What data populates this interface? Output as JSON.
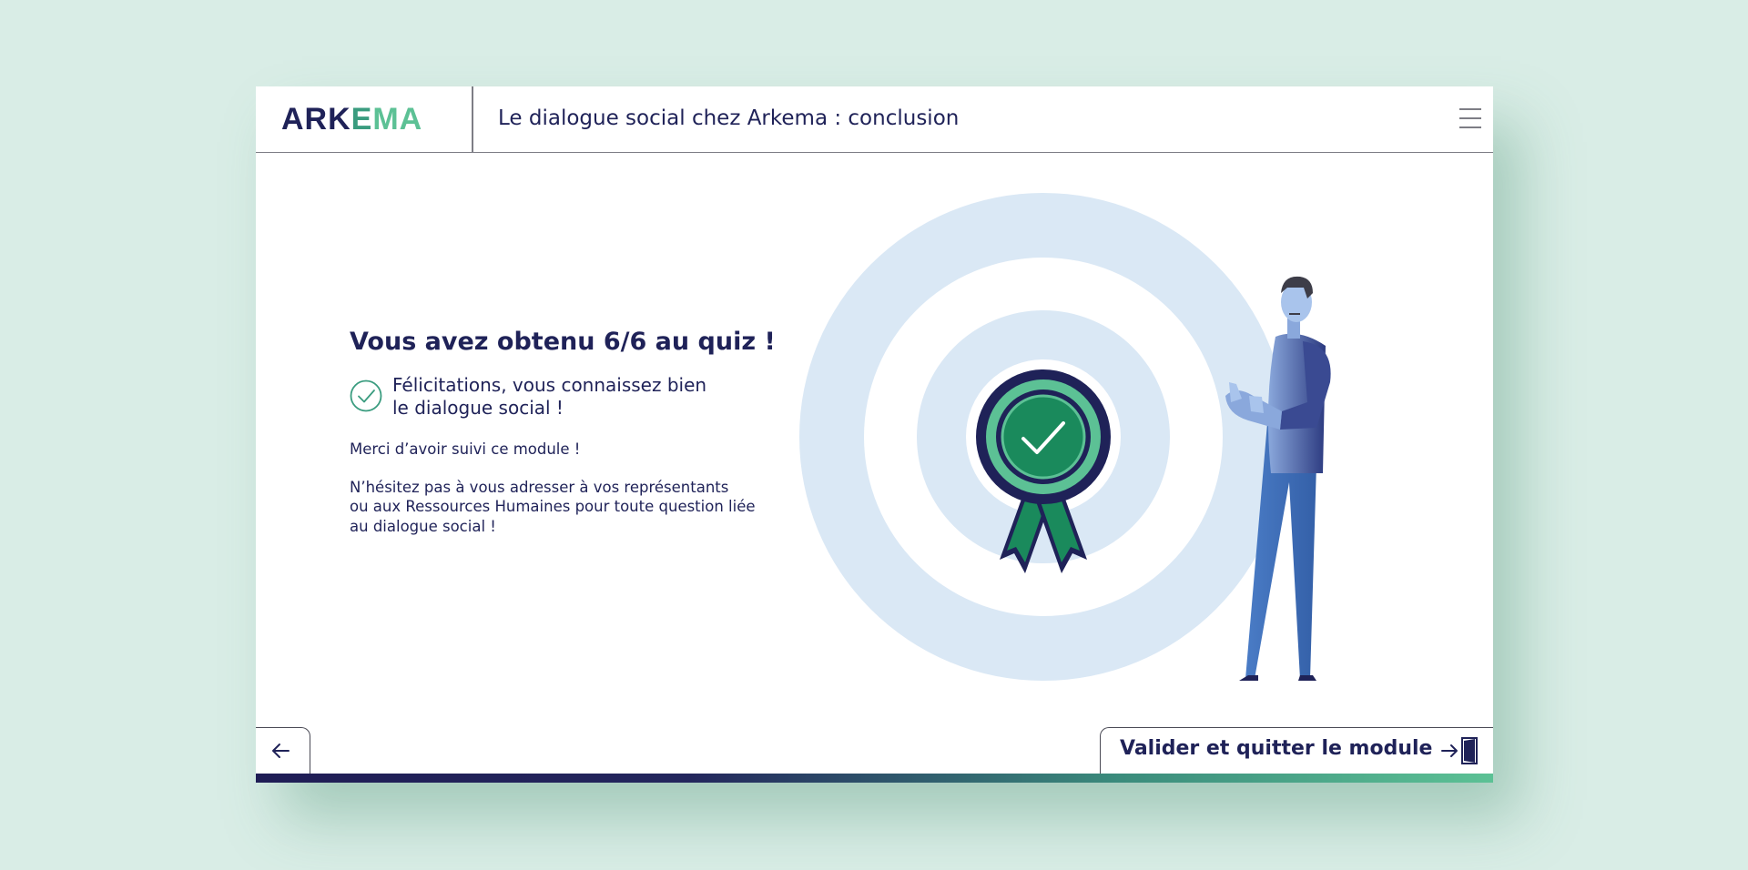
{
  "header": {
    "logo_text": "ARKEMA",
    "course_title": "Le dialogue social chez Arkema : conclusion"
  },
  "main": {
    "score_title": "Vous avez obtenu 6/6 au quiz !",
    "congrats_line1": "Félicitations, vous connaissez bien",
    "congrats_line2": "le dialogue social !",
    "thanks": "Merci d’avoir suivi ce module !",
    "contact_line1": "N’hésitez pas à vous adresser à vos représentants",
    "contact_line2": "ou aux Ressources Humaines pour toute question liée",
    "contact_line3": "au dialogue social !"
  },
  "footer": {
    "exit_label": "Valider et quitter le module",
    "progress": 1.0
  },
  "colors": {
    "navy": "#1f2258",
    "green": "#5cc195",
    "light_blue": "#dae8f5",
    "background": "#d9ede6"
  },
  "icons": {
    "menu": "hamburger-menu-icon",
    "check": "check-circle-icon",
    "back": "arrow-left-icon",
    "exit": "exit-door-icon"
  }
}
